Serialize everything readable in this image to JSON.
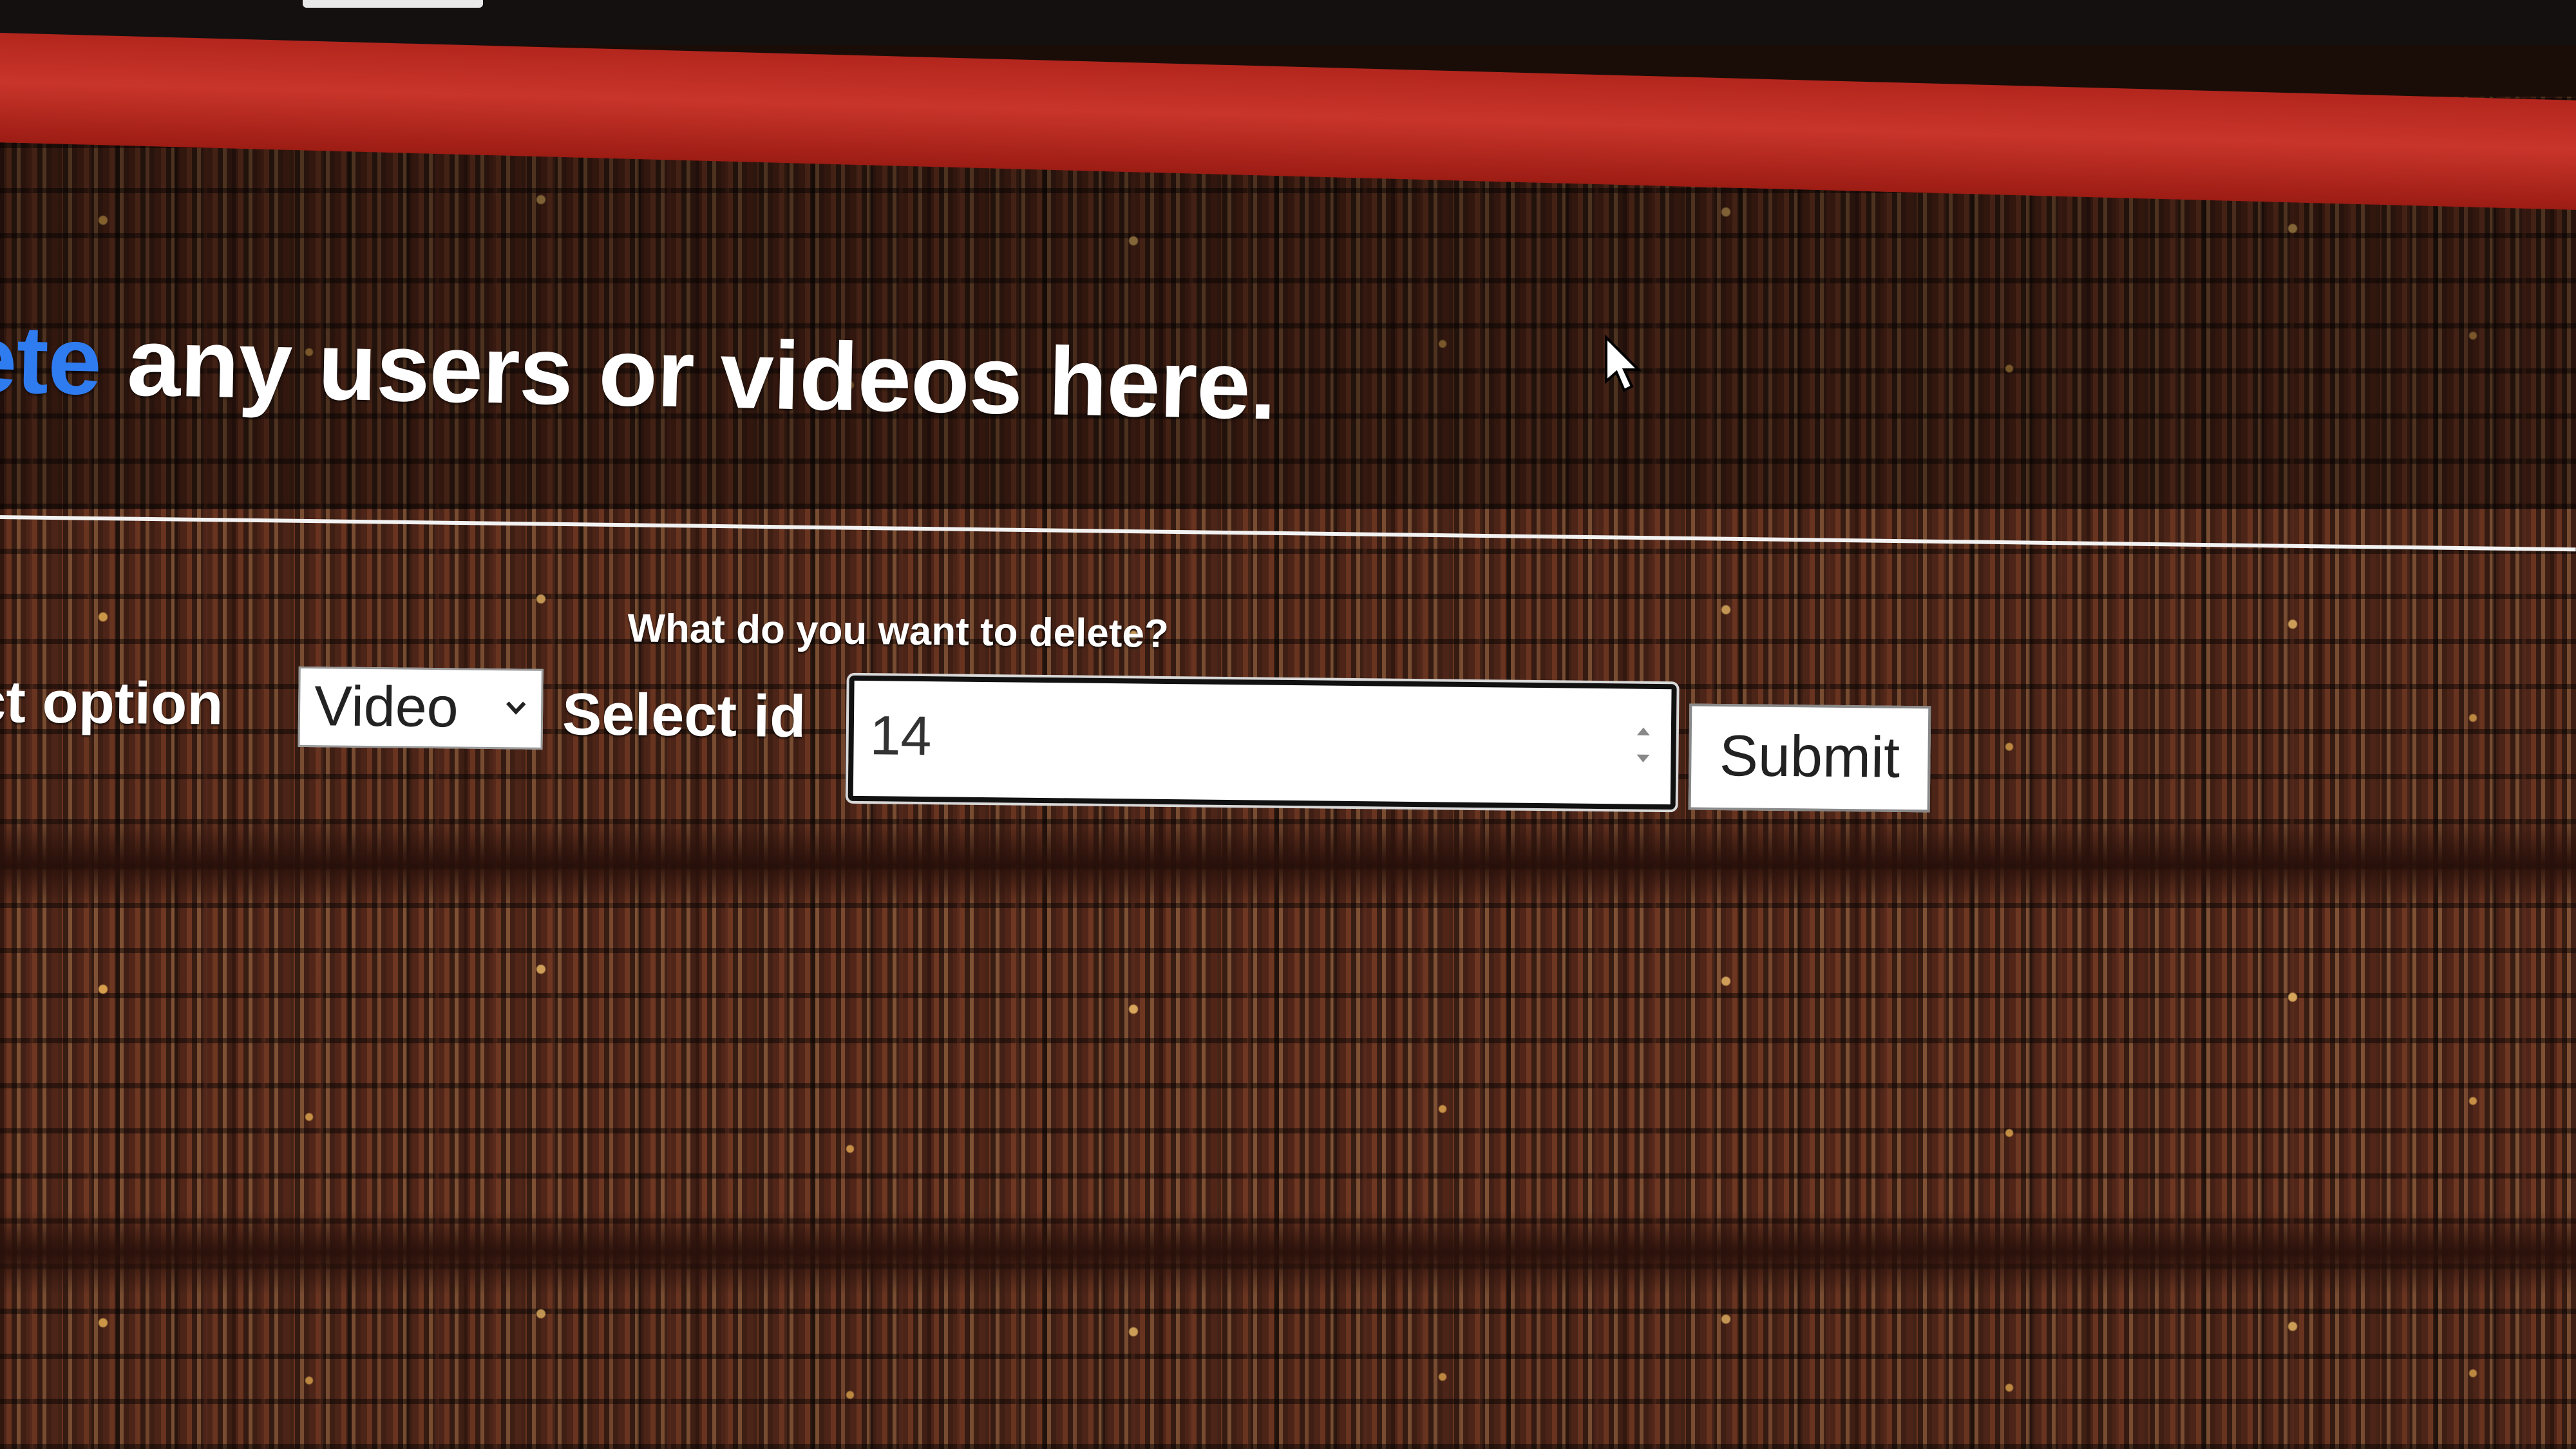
{
  "header": {
    "link_text": "ete",
    "heading_text": " any users or videos here."
  },
  "form": {
    "question": "What do you want to delete?",
    "option_label": "ct option",
    "selected_option": "Video",
    "id_label": "Select id",
    "id_value": "14",
    "submit_label": "Submit"
  },
  "icons": {
    "dropdown": "chevron-down-icon",
    "spinner": "number-spinner-icon",
    "cursor": "mouse-pointer-icon"
  },
  "colors": {
    "header_red": "#c9352a",
    "link_blue": "#2f7bf0"
  }
}
